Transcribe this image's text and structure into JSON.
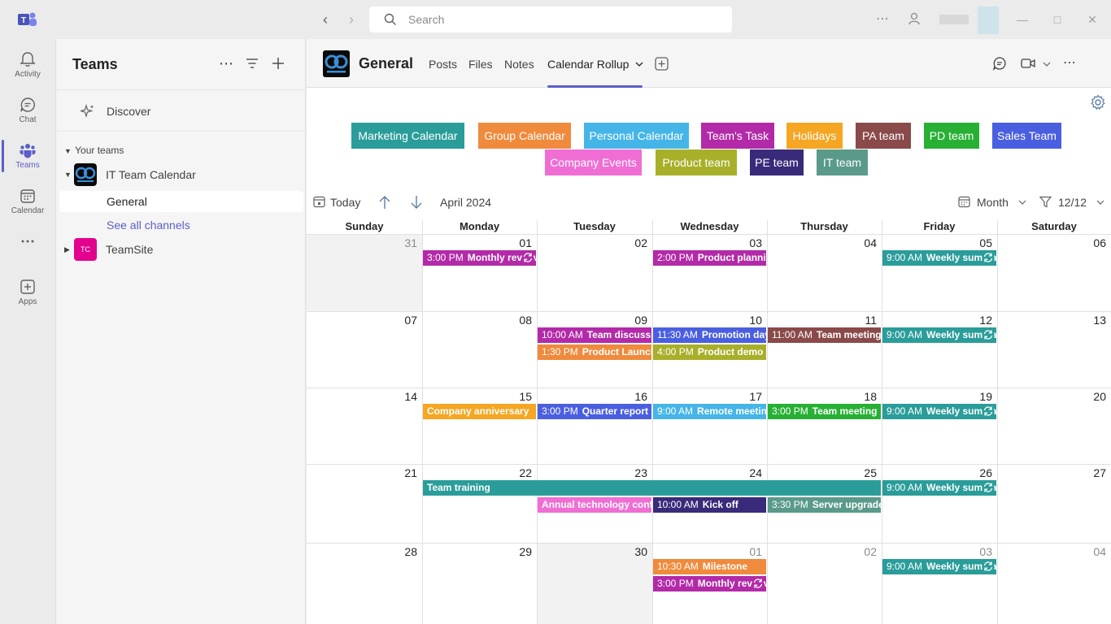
{
  "search": {
    "placeholder": "Search"
  },
  "rail": [
    {
      "label": "Activity",
      "icon": "bell-icon"
    },
    {
      "label": "Chat",
      "icon": "chat-icon"
    },
    {
      "label": "Teams",
      "icon": "teams-icon"
    },
    {
      "label": "Calendar",
      "icon": "calendar-icon"
    },
    {
      "label": "",
      "icon": "more-icon"
    },
    {
      "label": "Apps",
      "icon": "apps-icon"
    }
  ],
  "panel": {
    "title": "Teams",
    "discover": "Discover",
    "your_teams": "Your teams",
    "teams": [
      {
        "name": "IT Team Calendar"
      },
      {
        "name": "TeamSite",
        "initials": "TC",
        "color": "#e3008c"
      }
    ],
    "channels": [
      {
        "name": "General"
      },
      {
        "name": "See all channels"
      }
    ]
  },
  "header": {
    "channel": "General",
    "tabs": [
      "Posts",
      "Files",
      "Notes",
      "Calendar Rollup"
    ]
  },
  "legend": [
    {
      "label": "Marketing Calendar",
      "color": "#2a9d9a"
    },
    {
      "label": "Group Calendar",
      "color": "#f08a3c"
    },
    {
      "label": "Personal Calendar",
      "color": "#45b5e8"
    },
    {
      "label": "Team's Task",
      "color": "#b32aa8"
    },
    {
      "label": "Holidays",
      "color": "#f5a623"
    },
    {
      "label": "PA team",
      "color": "#8a4a4a"
    },
    {
      "label": "PD team",
      "color": "#27b034"
    },
    {
      "label": "Sales Team",
      "color": "#4a5fe0"
    },
    {
      "label": "Company Events",
      "color": "#f06ed4"
    },
    {
      "label": "Product team",
      "color": "#a8b02a"
    },
    {
      "label": "PE team",
      "color": "#3a2a7a"
    },
    {
      "label": "IT team",
      "color": "#5a9a8a"
    }
  ],
  "toolbar": {
    "today": "Today",
    "period": "April 2024",
    "view": "Month",
    "filter": "12/12"
  },
  "calendar": {
    "weekdays": [
      "Sunday",
      "Monday",
      "Tuesday",
      "Wednesday",
      "Thursday",
      "Friday",
      "Saturday"
    ],
    "weeks": [
      [
        "31",
        "01",
        "02",
        "03",
        "04",
        "05",
        "06"
      ],
      [
        "07",
        "08",
        "09",
        "10",
        "11",
        "12",
        "13"
      ],
      [
        "14",
        "15",
        "16",
        "17",
        "18",
        "19",
        "20"
      ],
      [
        "21",
        "22",
        "23",
        "24",
        "25",
        "26",
        "27"
      ],
      [
        "28",
        "29",
        "30",
        "01",
        "02",
        "03",
        "04"
      ]
    ],
    "events": [
      {
        "time": "3:00 PM",
        "name": "Monthly review",
        "color": "#b32aa8"
      },
      {
        "time": "2:00 PM",
        "name": "Product planning",
        "color": "#b32aa8"
      },
      {
        "time": "9:00 AM",
        "name": "Weekly summary",
        "color": "#2a9d9a"
      },
      {
        "time": "10:00 AM",
        "name": "Team discussion",
        "color": "#b32aa8"
      },
      {
        "time": "1:30 PM",
        "name": "Product Launch",
        "color": "#f08a3c"
      },
      {
        "time": "11:30 AM",
        "name": "Promotion day",
        "color": "#4a5fe0"
      },
      {
        "time": "4:00 PM",
        "name": "Product demo",
        "color": "#a8b02a"
      },
      {
        "time": "11:00 AM",
        "name": "Team meeting",
        "color": "#8a4a4a"
      },
      {
        "time": "9:00 AM",
        "name": "Weekly summary",
        "color": "#2a9d9a"
      },
      {
        "time": "",
        "name": "Company anniversary",
        "color": "#f5a623"
      },
      {
        "time": "3:00 PM",
        "name": "Quarter report",
        "color": "#4a5fe0"
      },
      {
        "time": "9:00 AM",
        "name": "Remote meeting",
        "color": "#45b5e8"
      },
      {
        "time": "3:00 PM",
        "name": "Team meeting",
        "color": "#27b034"
      },
      {
        "time": "9:00 AM",
        "name": "Weekly summary",
        "color": "#2a9d9a"
      },
      {
        "time": "",
        "name": "Team training",
        "color": "#2a9d9a"
      },
      {
        "time": "9:00 AM",
        "name": "Weekly summary",
        "color": "#2a9d9a"
      },
      {
        "time": "",
        "name": "Annual technology conference",
        "color": "#f06ed4"
      },
      {
        "time": "10:00 AM",
        "name": "Kick off",
        "color": "#3a2a7a"
      },
      {
        "time": "3:30 PM",
        "name": "Server upgrade",
        "color": "#5a9a8a"
      },
      {
        "time": "10:30 AM",
        "name": "Milestone",
        "color": "#f08a3c"
      },
      {
        "time": "3:00 PM",
        "name": "Monthly review",
        "color": "#b32aa8"
      },
      {
        "time": "9:00 AM",
        "name": "Weekly summary",
        "color": "#2a9d9a"
      }
    ]
  }
}
